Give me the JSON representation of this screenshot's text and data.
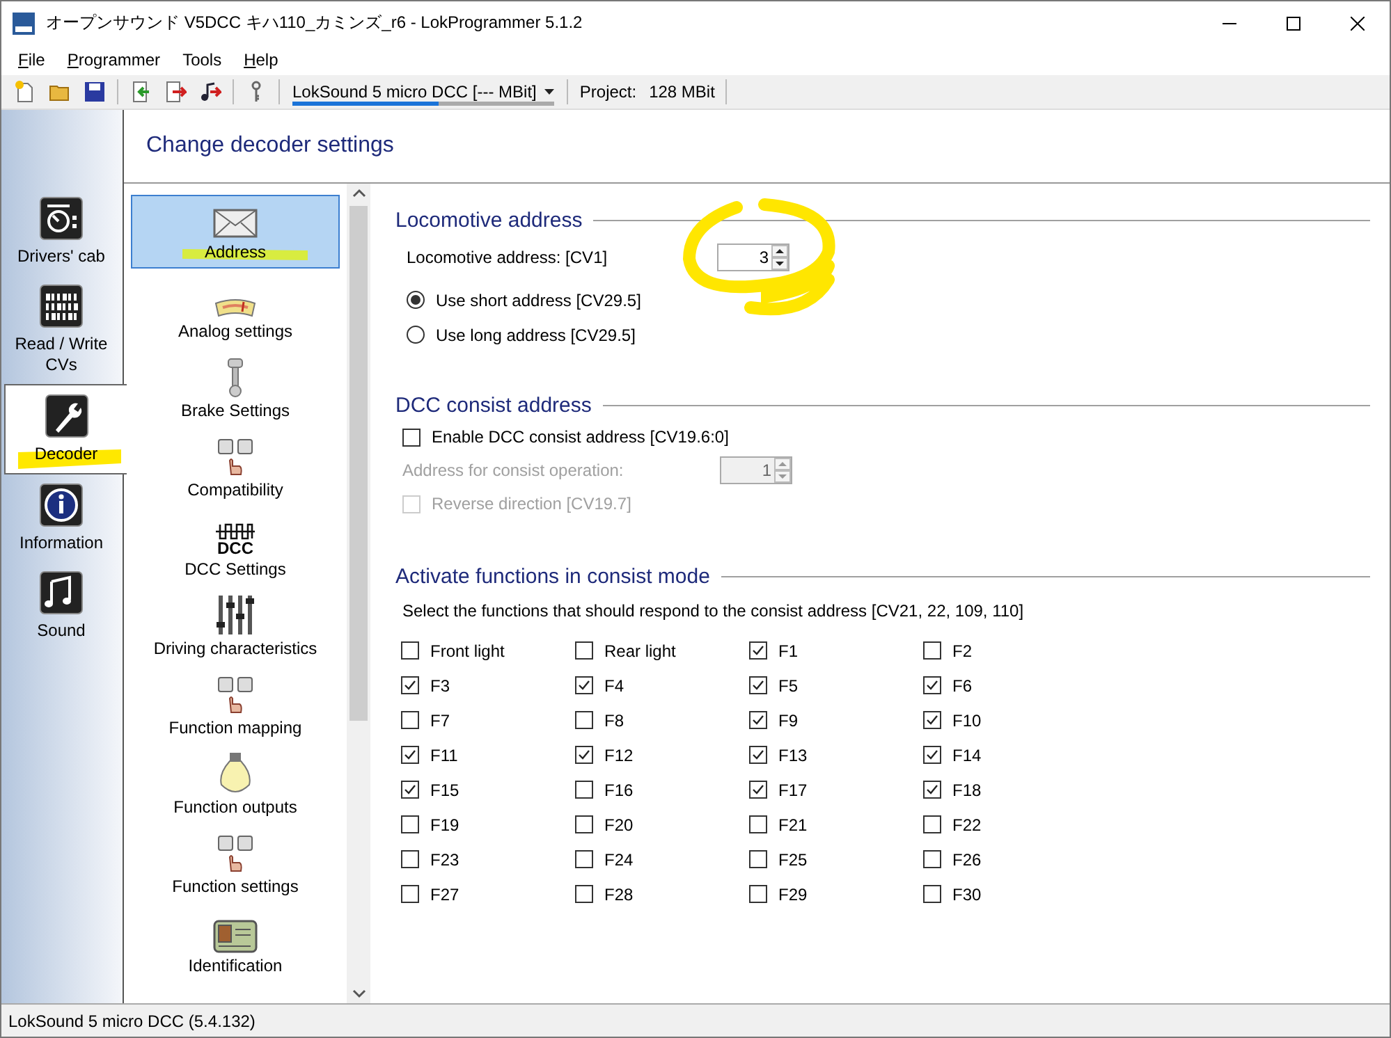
{
  "window": {
    "title": "オープンサウンド V5DCC キハ110_カミンズ_r6 - LokProgrammer 5.1.2"
  },
  "menu": [
    {
      "label": "File",
      "underline_first": true
    },
    {
      "label": "Programmer",
      "underline_first": true
    },
    {
      "label": "Tools",
      "underline_first": false
    },
    {
      "label": "Help",
      "underline_first": true
    }
  ],
  "toolbar": {
    "device": "LokSound 5 micro DCC [--- MBit]",
    "level": 0.56,
    "project_label": "Project:",
    "project_size": "128 MBit"
  },
  "nav": [
    {
      "label": "Drivers' cab",
      "kind": "cab",
      "selected": false
    },
    {
      "label": "Read / Write CVs",
      "kind": "binary",
      "selected": false
    },
    {
      "label": "Decoder",
      "kind": "wrench",
      "selected": true
    },
    {
      "label": "Information",
      "kind": "info",
      "selected": false
    },
    {
      "label": "Sound",
      "kind": "notes",
      "selected": false
    }
  ],
  "page_title": "Change decoder settings",
  "categories": [
    {
      "label": "Address",
      "kind": "envelope",
      "selected": true
    },
    {
      "label": "Analog settings",
      "kind": "gauge",
      "selected": false
    },
    {
      "label": "Brake Settings",
      "kind": "brake",
      "selected": false
    },
    {
      "label": "Compatibility",
      "kind": "keys",
      "selected": false
    },
    {
      "label": "DCC Settings",
      "kind": "dcc",
      "icon_caption": "DCC",
      "selected": false
    },
    {
      "label": "Driving characteristics",
      "kind": "sliders",
      "selected": false
    },
    {
      "label": "Function mapping",
      "kind": "keys",
      "selected": false
    },
    {
      "label": "Function outputs",
      "kind": "bulb",
      "selected": false
    },
    {
      "label": "Function settings",
      "kind": "keys",
      "selected": false
    },
    {
      "label": "Identification",
      "kind": "card",
      "selected": false
    }
  ],
  "loco": {
    "title": "Locomotive address",
    "address_label": "Locomotive address: [CV1]",
    "address_value": "3",
    "radios": [
      {
        "label": "Use short address [CV29.5]",
        "selected": true
      },
      {
        "label": "Use long address [CV29.5]",
        "selected": false
      }
    ]
  },
  "consist": {
    "title": "DCC consist address",
    "enable": {
      "label": "Enable DCC consist address [CV19.6:0]",
      "checked": false
    },
    "address_label": "Address for consist operation:",
    "address_value": "1",
    "disabled": true,
    "reverse": {
      "label": "Reverse direction [CV19.7]",
      "checked": false
    }
  },
  "functions": {
    "title": "Activate functions in consist mode",
    "hint": "Select the functions that should respond to the consist address [CV21, 22, 109, 110]",
    "items": [
      {
        "label": "Front light",
        "checked": false
      },
      {
        "label": "Rear light",
        "checked": false
      },
      {
        "label": "F1",
        "checked": true
      },
      {
        "label": "F2",
        "checked": false
      },
      {
        "label": "F3",
        "checked": true
      },
      {
        "label": "F4",
        "checked": true
      },
      {
        "label": "F5",
        "checked": true
      },
      {
        "label": "F6",
        "checked": true
      },
      {
        "label": "F7",
        "checked": false
      },
      {
        "label": "F8",
        "checked": false
      },
      {
        "label": "F9",
        "checked": true
      },
      {
        "label": "F10",
        "checked": true
      },
      {
        "label": "F11",
        "checked": true
      },
      {
        "label": "F12",
        "checked": true
      },
      {
        "label": "F13",
        "checked": true
      },
      {
        "label": "F14",
        "checked": true
      },
      {
        "label": "F15",
        "checked": true
      },
      {
        "label": "F16",
        "checked": false
      },
      {
        "label": "F17",
        "checked": true
      },
      {
        "label": "F18",
        "checked": true
      },
      {
        "label": "F19",
        "checked": false
      },
      {
        "label": "F20",
        "checked": false
      },
      {
        "label": "F21",
        "checked": false
      },
      {
        "label": "F22",
        "checked": false
      },
      {
        "label": "F23",
        "checked": false
      },
      {
        "label": "F24",
        "checked": false
      },
      {
        "label": "F25",
        "checked": false
      },
      {
        "label": "F26",
        "checked": false
      },
      {
        "label": "F27",
        "checked": false
      },
      {
        "label": "F28",
        "checked": false
      },
      {
        "label": "F29",
        "checked": false
      },
      {
        "label": "F30",
        "checked": false
      }
    ]
  },
  "status_bar": "LokSound 5 micro DCC (5.4.132)"
}
